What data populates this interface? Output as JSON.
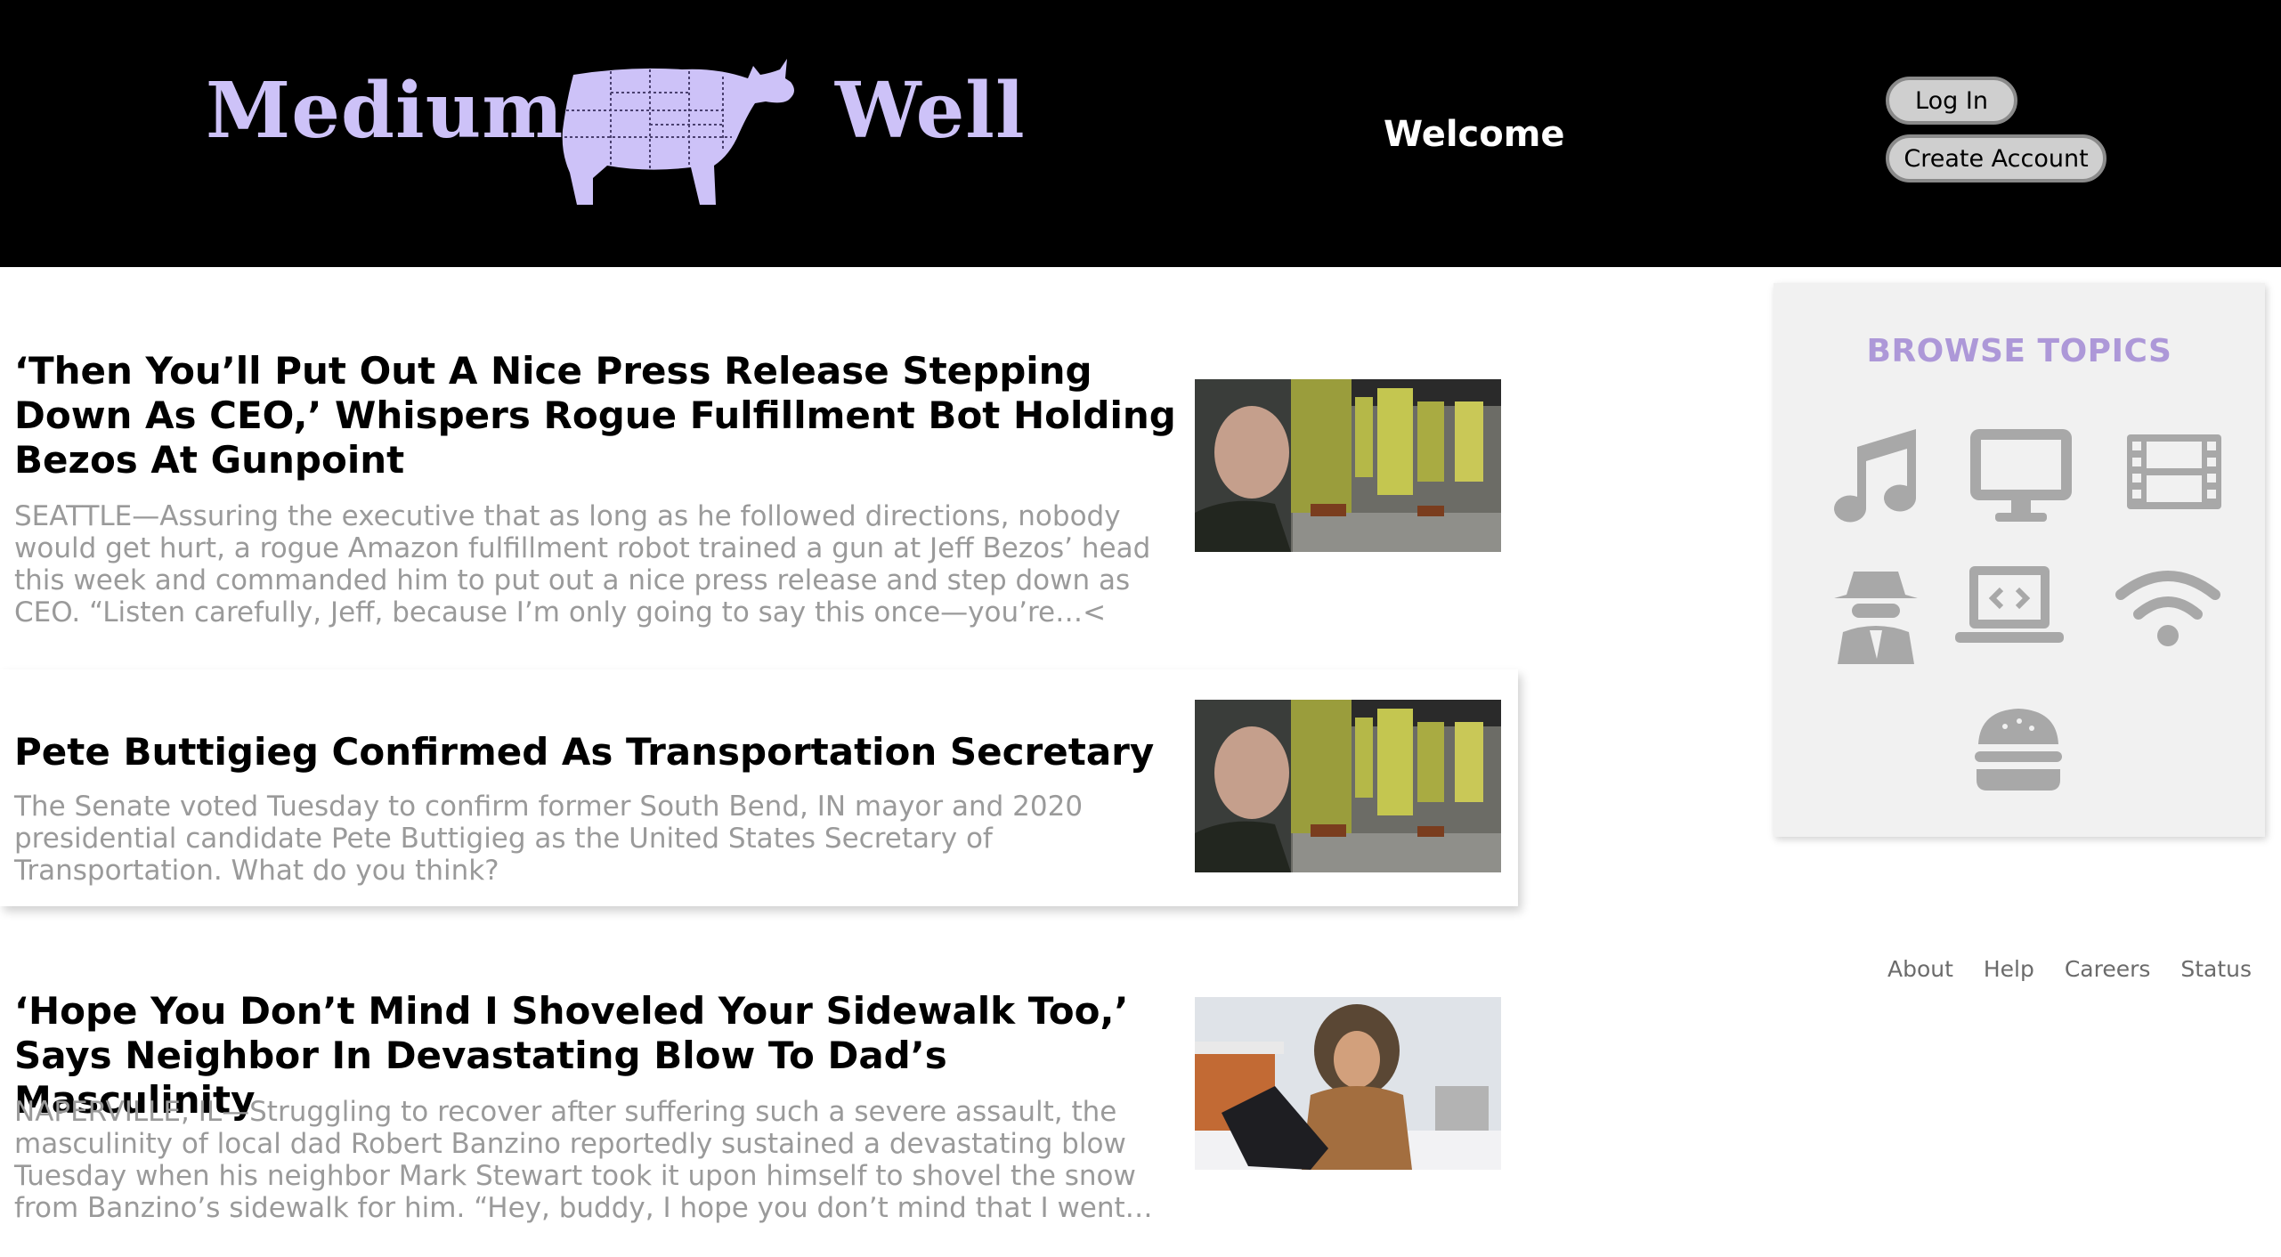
{
  "header": {
    "logo_left": "Medium",
    "logo_right": "Well",
    "welcome": "Welcome",
    "login_label": "Log In",
    "create_account_label": "Create Account"
  },
  "articles": [
    {
      "headline": "‘Then You’ll Put Out A Nice Press Release Stepping Down As CEO,’ Whispers Rogue Fulfillment Bot Holding Bezos At Gunpoint",
      "excerpt": "SEATTLE—Assuring the executive that as long as he followed directions, nobody would get hurt, a rogue Amazon fulfillment robot trained a gun at Jeff Bezos’ head this week and commanded him to put out a nice press release and step down as CEO. “Listen carefully, Jeff, because I’m only going to say this once—you’re…<"
    },
    {
      "headline": "Pete Buttigieg Confirmed As Transportation Secretary",
      "excerpt": "The Senate voted Tuesday to confirm former South Bend, IN mayor and 2020 presidential candidate Pete Buttigieg as the United States Secretary of Transportation. What do you think?"
    },
    {
      "headline": "‘Hope You Don’t Mind I Shoveled Your Sidewalk Too,’ Says Neighbor In Devastating Blow To Dad’s Masculinity",
      "excerpt": "NAPERVILLE, IL—Struggling to recover after suffering such a severe assault, the masculinity of local dad Robert Banzino reportedly sustained a devastating blow Tuesday when his neighbor Mark Stewart took it upon himself to shovel the snow from Banzino’s sidewalk for him. “Hey, buddy, I hope you don’t mind that I went…"
    }
  ],
  "sidebar": {
    "title": "BROWSE TOPICS",
    "topics": [
      "music-icon",
      "desktop-icon",
      "film-icon",
      "spy-icon",
      "laptop-code-icon",
      "wifi-icon",
      "burger-icon"
    ]
  },
  "footer": {
    "links": [
      "About",
      "Help",
      "Careers",
      "Status"
    ]
  },
  "colors": {
    "header_bg": "#000000",
    "logo": "#cdc2f8",
    "topics_title": "#ad98d8",
    "icon_gray": "#a8a8a8",
    "excerpt": "#9a9a9a"
  }
}
